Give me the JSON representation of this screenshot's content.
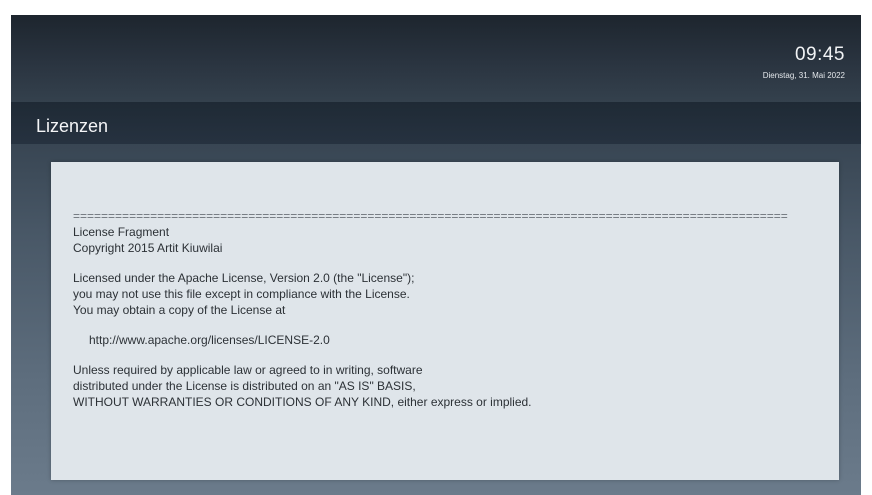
{
  "header": {
    "time": "09:45",
    "date": "Dienstag, 31. Mai 2022"
  },
  "page": {
    "title": "Lizenzen"
  },
  "license": {
    "separator": "======================================================================================================",
    "lines_block1": [
      "License Fragment",
      "Copyright 2015 Artit Kiuwilai"
    ],
    "lines_block2": [
      "Licensed under the Apache License, Version 2.0 (the \"License\");",
      "you may not use this file except in compliance with the License.",
      "You may obtain a copy of the License at"
    ],
    "url": "http://www.apache.org/licenses/LICENSE-2.0",
    "lines_block3": [
      "Unless required by applicable law or agreed to in writing, software",
      "distributed under the License is distributed on an \"AS IS\" BASIS,",
      "WITHOUT WARRANTIES OR CONDITIONS OF ANY KIND, either express or implied."
    ]
  }
}
